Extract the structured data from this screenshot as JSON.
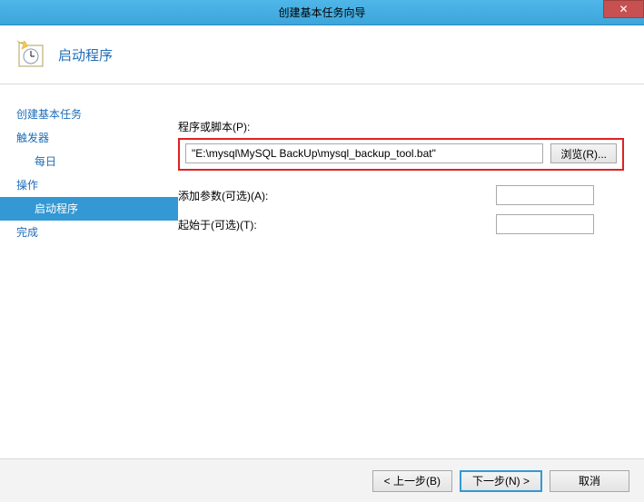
{
  "window": {
    "title": "创建基本任务向导",
    "close_glyph": "✕"
  },
  "header": {
    "title": "启动程序"
  },
  "sidebar": {
    "items": [
      {
        "label": "创建基本任务",
        "sub": false,
        "selected": false
      },
      {
        "label": "触发器",
        "sub": false,
        "selected": false
      },
      {
        "label": "每日",
        "sub": true,
        "selected": false
      },
      {
        "label": "操作",
        "sub": false,
        "selected": false
      },
      {
        "label": "启动程序",
        "sub": true,
        "selected": true
      },
      {
        "label": "完成",
        "sub": false,
        "selected": false
      }
    ]
  },
  "form": {
    "script_label": "程序或脚本(P):",
    "script_value": "\"E:\\mysql\\MySQL BackUp\\mysql_backup_tool.bat\"",
    "browse_label": "浏览(R)...",
    "args_label": "添加参数(可选)(A):",
    "args_value": "",
    "startin_label": "起始于(可选)(T):",
    "startin_value": ""
  },
  "footer": {
    "back": "< 上一步(B)",
    "next": "下一步(N) >",
    "cancel": "取消"
  }
}
